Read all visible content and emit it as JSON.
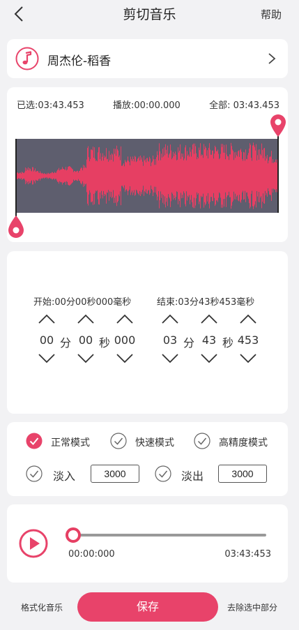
{
  "header": {
    "title": "剪切音乐",
    "help_label": "帮助"
  },
  "song": {
    "title": "周杰伦-稻香",
    "icon": "music-note-icon"
  },
  "selection": {
    "selected": "已选:03:43.453",
    "playing": "播放:00:00.000",
    "total": "全部: 03:43.453"
  },
  "trim": {
    "start_label": "开始:00分00秒000毫秒",
    "end_label": "结束:03分43秒453毫秒",
    "start": {
      "min": "00",
      "sec": "00",
      "ms": "000"
    },
    "end": {
      "min": "03",
      "sec": "43",
      "ms": "453"
    },
    "unit_min": "分",
    "unit_sec": "秒"
  },
  "modes": {
    "normal": {
      "label": "正常模式",
      "checked": true
    },
    "fast": {
      "label": "快速模式",
      "checked": false
    },
    "precise": {
      "label": "高精度模式",
      "checked": false
    }
  },
  "fade": {
    "in_label": "淡入",
    "in_value": "3000",
    "in_checked": false,
    "out_label": "淡出",
    "out_value": "3000",
    "out_checked": false
  },
  "player": {
    "current": "00:00:000",
    "total": "03:43:453",
    "progress_fraction": 0
  },
  "footer": {
    "format_label": "格式化音乐",
    "save_label": "保存",
    "remove_label": "去除选中部分"
  },
  "colors": {
    "accent": "#e8436a",
    "waveform_bg": "#5e5e6e",
    "waveform_fg": "#e63f63"
  }
}
